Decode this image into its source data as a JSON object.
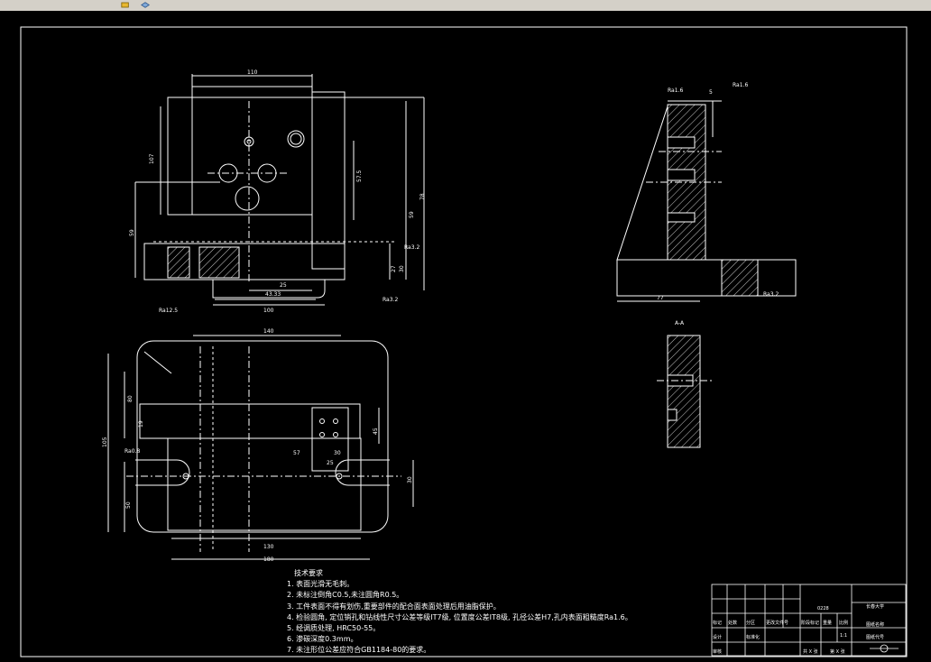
{
  "app": {
    "toolbar_icons": [
      "pencil-icon",
      "layer-icon"
    ]
  },
  "drawing": {
    "front_view_dims": [
      "110",
      "107",
      "59",
      "57.5",
      "78",
      "59",
      "27",
      "30",
      "25",
      "43.33",
      "100"
    ],
    "side_view_dims": [
      "5",
      "77"
    ],
    "top_view_dims": [
      "140",
      "80",
      "105",
      "19",
      "45",
      "57",
      "30",
      "25",
      "50",
      "130",
      "180"
    ],
    "section_label": "A-A",
    "roughness_labels": [
      "Ra12.5",
      "Ra3.2",
      "Ra0.8",
      "Ra1.6"
    ]
  },
  "notes": {
    "title": "技术要求",
    "lines": [
      "1. 表面光滑无毛刺。",
      "2. 未标注倒角C0.5,未注圆角R0.5。",
      "3. 工件表面不得有划伤,重要部件的配合面表面处理后用油脂保护。",
      "4. 检验圆角, 定位销孔和钻线性尺寸公差等级IT7级, 位置度公差IT8级, 孔径公差H7,孔内表面粗糙度Ra1.6。",
      "5. 经调质处理, HRC50-55。",
      "6. 渗碳深度0.3mm。",
      "7. 未注形位公差应符合GB1184-80的要求。"
    ]
  },
  "title_block": {
    "drawing_no": "0228",
    "school": "长春大学",
    "part_name": "图纸名称",
    "drawing_name": "图纸代号",
    "scale_label": "比例",
    "scale_value": "1:1",
    "sheet_label": "共 X 张",
    "sheet_label2": "第 X 张",
    "labels": [
      "标记",
      "处数",
      "分区",
      "更改文件号",
      "签名",
      "年月日",
      "设计",
      "标准化",
      "审核",
      "工艺",
      "批准",
      "阶段标记",
      "重量",
      "比例"
    ]
  }
}
